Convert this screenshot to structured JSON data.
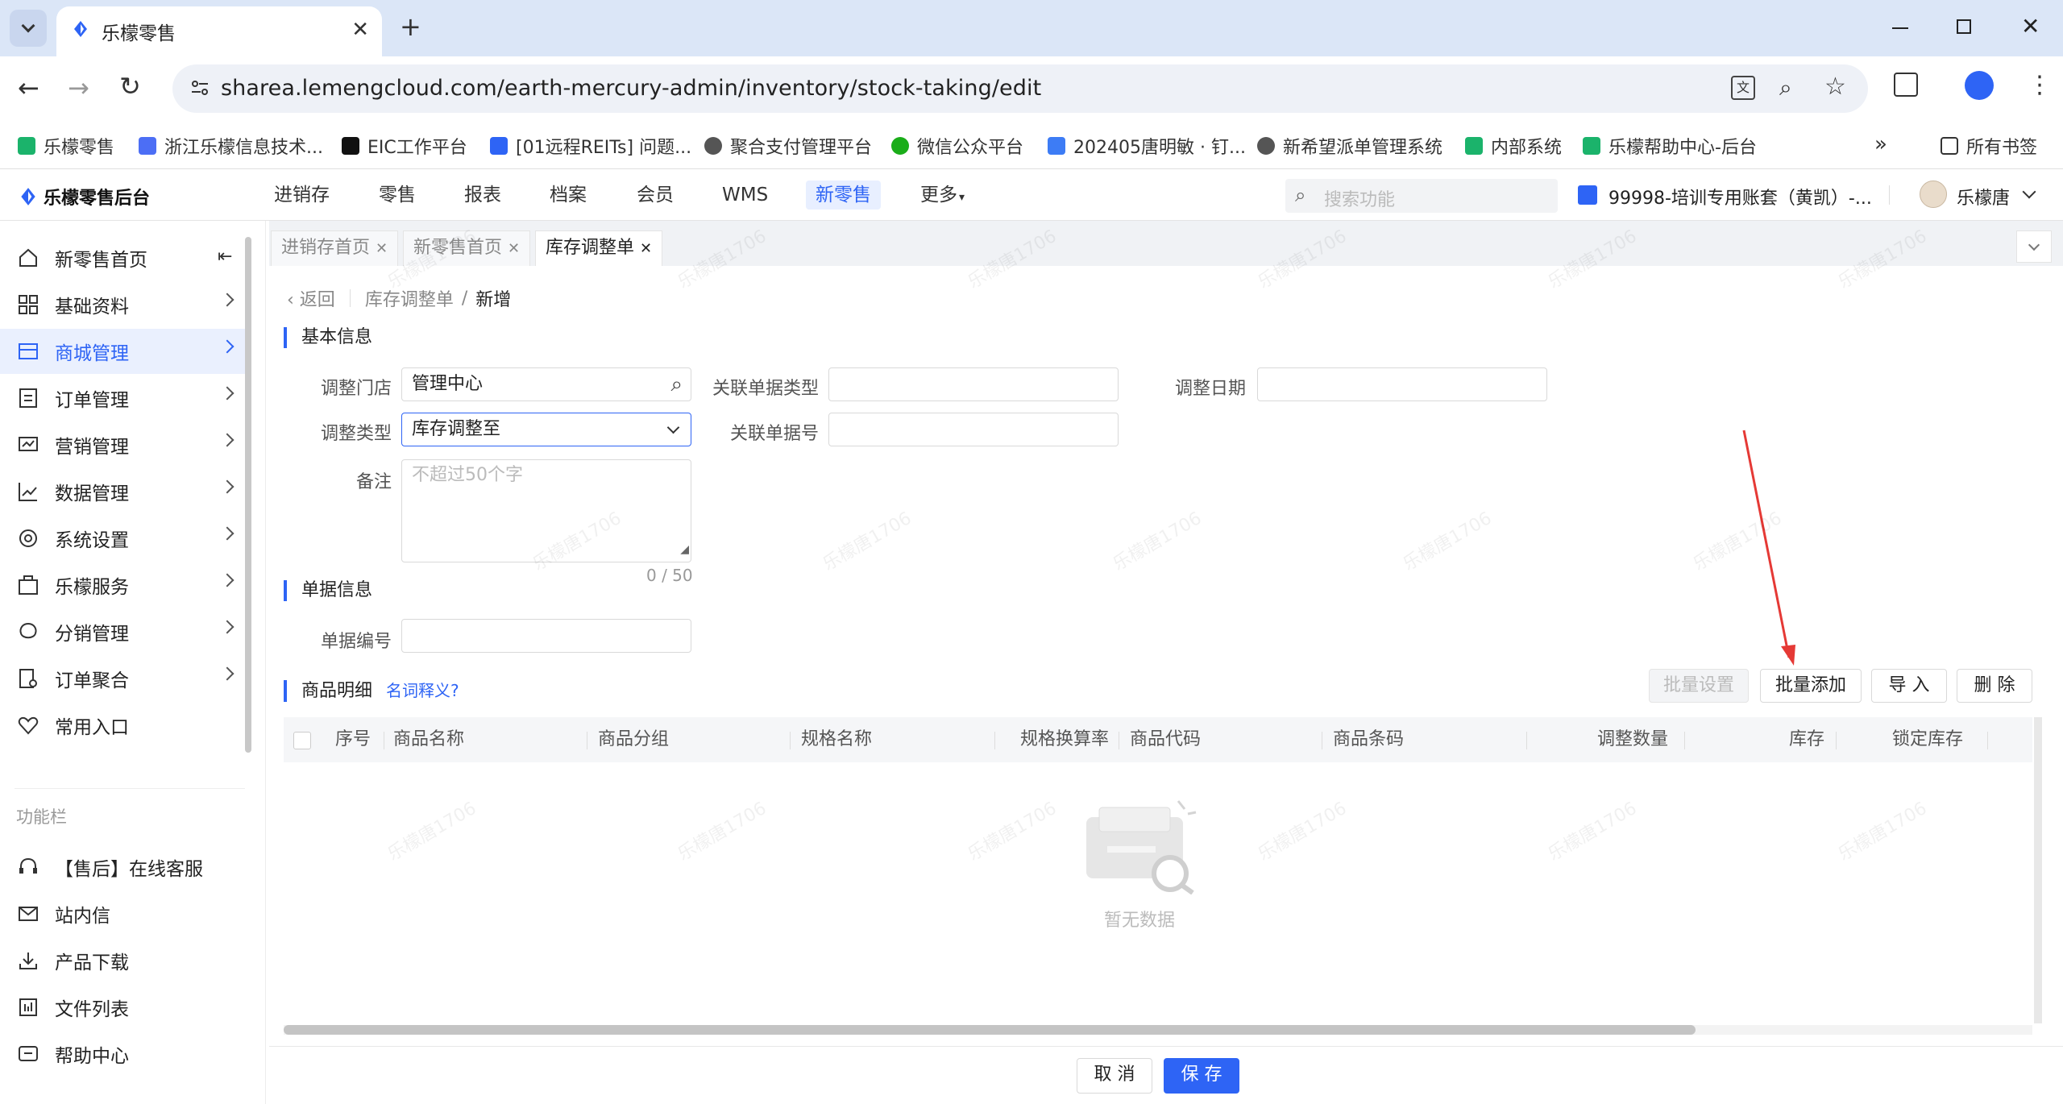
{
  "browser": {
    "tab_title": "乐檬零售",
    "url": "sharea.lemengcloud.com/earth-mercury-admin/inventory/stock-taking/edit",
    "bookmarks": [
      {
        "label": "乐檬零售",
        "color": "#1bb36b"
      },
      {
        "label": "浙江乐檬信息技术...",
        "color": "#4c6ef5"
      },
      {
        "label": "EIC工作平台",
        "color": "#111111"
      },
      {
        "label": "[01远程REITs] 问题...",
        "color": "#2e64f5"
      },
      {
        "label": "聚合支付管理平台",
        "color": "#555555"
      },
      {
        "label": "微信公众平台",
        "color": "#1aad19"
      },
      {
        "label": "202405唐明敏 · 钉...",
        "color": "#3d7cf5"
      },
      {
        "label": "新希望派单管理系统",
        "color": "#555555"
      },
      {
        "label": "内部系统",
        "color": "#1bb36b"
      },
      {
        "label": "乐檬帮助中心-后台",
        "color": "#1bb36b"
      }
    ],
    "all_bookmarks": "所有书签"
  },
  "app": {
    "logo": "乐檬零售后台",
    "nav": [
      "进销存",
      "零售",
      "报表",
      "档案",
      "会员",
      "WMS",
      "新零售",
      "更多"
    ],
    "active_nav": "新零售",
    "search_placeholder": "搜索功能",
    "account": "99998-培训专用账套（黄凯）-...",
    "user": "乐檬唐",
    "accent": "#2e64f5"
  },
  "sidebar": {
    "items": [
      {
        "label": "新零售首页",
        "icon": "home-icon"
      },
      {
        "label": "基础资料",
        "icon": "grid-icon"
      },
      {
        "label": "商城管理",
        "icon": "store-icon"
      },
      {
        "label": "订单管理",
        "icon": "order-icon"
      },
      {
        "label": "营销管理",
        "icon": "marketing-icon"
      },
      {
        "label": "数据管理",
        "icon": "chart-icon"
      },
      {
        "label": "系统设置",
        "icon": "settings-icon"
      },
      {
        "label": "乐檬服务",
        "icon": "service-icon"
      },
      {
        "label": "分销管理",
        "icon": "distribution-icon"
      },
      {
        "label": "订单聚合",
        "icon": "aggregate-icon"
      },
      {
        "label": "常用入口",
        "icon": "heart-icon"
      }
    ],
    "section_label": "功能栏",
    "func_items": [
      {
        "label": "【售后】在线客服",
        "icon": "headset-icon"
      },
      {
        "label": "站内信",
        "icon": "mail-icon"
      },
      {
        "label": "产品下载",
        "icon": "download-icon"
      },
      {
        "label": "文件列表",
        "icon": "file-list-icon"
      },
      {
        "label": "帮助中心",
        "icon": "help-icon"
      }
    ]
  },
  "page_tabs": [
    "进销存首页",
    "新零售首页",
    "库存调整单"
  ],
  "breadcrumb": {
    "back": "返回",
    "parent": "库存调整单",
    "current": "新增"
  },
  "basic": {
    "section": "基本信息",
    "store_label": "调整门店",
    "store_value": "管理中心",
    "type_label": "调整类型",
    "type_value": "库存调整至",
    "related_type_label": "关联单据类型",
    "related_no_label": "关联单据号",
    "date_label": "调整日期",
    "remark_label": "备注",
    "remark_placeholder": "不超过50个字",
    "counter": "0 / 50"
  },
  "doc": {
    "section": "单据信息",
    "no_label": "单据编号"
  },
  "detail": {
    "section": "商品明细",
    "glossary": "名词释义?",
    "buttons": {
      "batch_set": "批量设置",
      "batch_add": "批量添加",
      "import": "导 入",
      "delete": "删 除"
    },
    "columns": [
      "序号",
      "商品名称",
      "商品分组",
      "规格名称",
      "规格换算率",
      "商品代码",
      "商品条码",
      "调整数量",
      "库存",
      "锁定库存"
    ],
    "empty": "暂无数据"
  },
  "footer": {
    "cancel": "取 消",
    "save": "保 存"
  }
}
